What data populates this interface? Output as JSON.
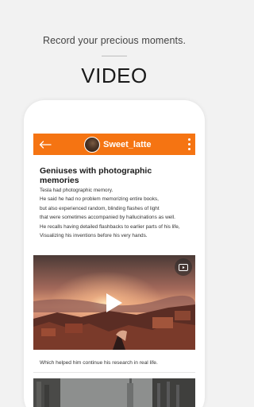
{
  "promo": {
    "tagline": "Record your precious moments.",
    "headline": "VIDEO"
  },
  "appbar": {
    "back_icon": "arrow-left-icon",
    "username": "Sweet_latte",
    "more_icon": "vertical-dots-icon",
    "color": "#f57412"
  },
  "post": {
    "title": "Geniuses with photographic memories",
    "lines": [
      "Tesla had photographic memory.",
      "He said he had no problem memorizing entire books,",
      "but also experienced random, blinding flashes of light",
      "that were sometimes accompanied by hallucinations as well.",
      "He recalls having detailed flashbacks to earlier parts of his life,",
      "Visualizing his inventions before his very hands."
    ],
    "video": {
      "play_icon": "play-icon",
      "badge_icon": "youtube-icon"
    },
    "caption": "Which helped him continue his research in real life."
  }
}
